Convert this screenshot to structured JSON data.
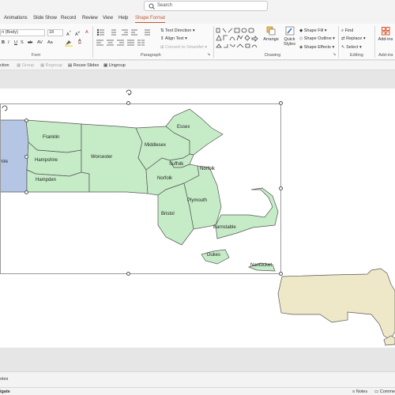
{
  "search": {
    "placeholder": "Search"
  },
  "tabs": [
    "Animations",
    "Slide Show",
    "Record",
    "Review",
    "View",
    "Help",
    "Shape Format"
  ],
  "ribbon": {
    "font_name": "ri (Body)",
    "font_size": "18",
    "groups": {
      "font": "Font",
      "paragraph": "Paragraph",
      "drawing": "Drawing",
      "editing": "Editing",
      "addins": "Add-ins"
    },
    "text_direction": "Text Direction",
    "align_text": "Align Text",
    "convert_smartart": "Convert to SmartArt",
    "arrange": "Arrange",
    "quick_styles": "Quick Styles",
    "shape_fill": "Shape Fill",
    "shape_outline": "Shape Outline",
    "shape_effects": "Shape Effects",
    "find": "Find",
    "replace": "Replace",
    "select": "Select",
    "addins": "Add-ins"
  },
  "arrange_bar": {
    "action": "ction",
    "group": "Group",
    "regroup": "Regroup",
    "reuse_slides": "Reuse Slides",
    "ungroup": "Ungroup"
  },
  "map": {
    "counties": {
      "berkshire": "hire",
      "franklin": "Franklin",
      "hampshire": "Hampshire",
      "hampden": "Hampden",
      "worcester": "Worcester",
      "middlesex": "Middlesex",
      "essex": "Essex",
      "suffolk": "Suffolk",
      "norfolk": "Norfolk",
      "norfolk2": "Norfolk",
      "bristol": "Bristol",
      "plymouth": "Plymouth",
      "barnstable": "Barnstable",
      "dukes": "Dukes",
      "nantucket": "Nantucket"
    },
    "colors": {
      "county_fill": "#c6ecc7",
      "berkshire_fill": "#b4c6e4",
      "state_fill": "#eee8c8",
      "border": "#555555"
    }
  },
  "notes": {
    "label": "otes"
  },
  "status": {
    "left": "igate",
    "notes": "Notes",
    "comments": "Comme"
  }
}
